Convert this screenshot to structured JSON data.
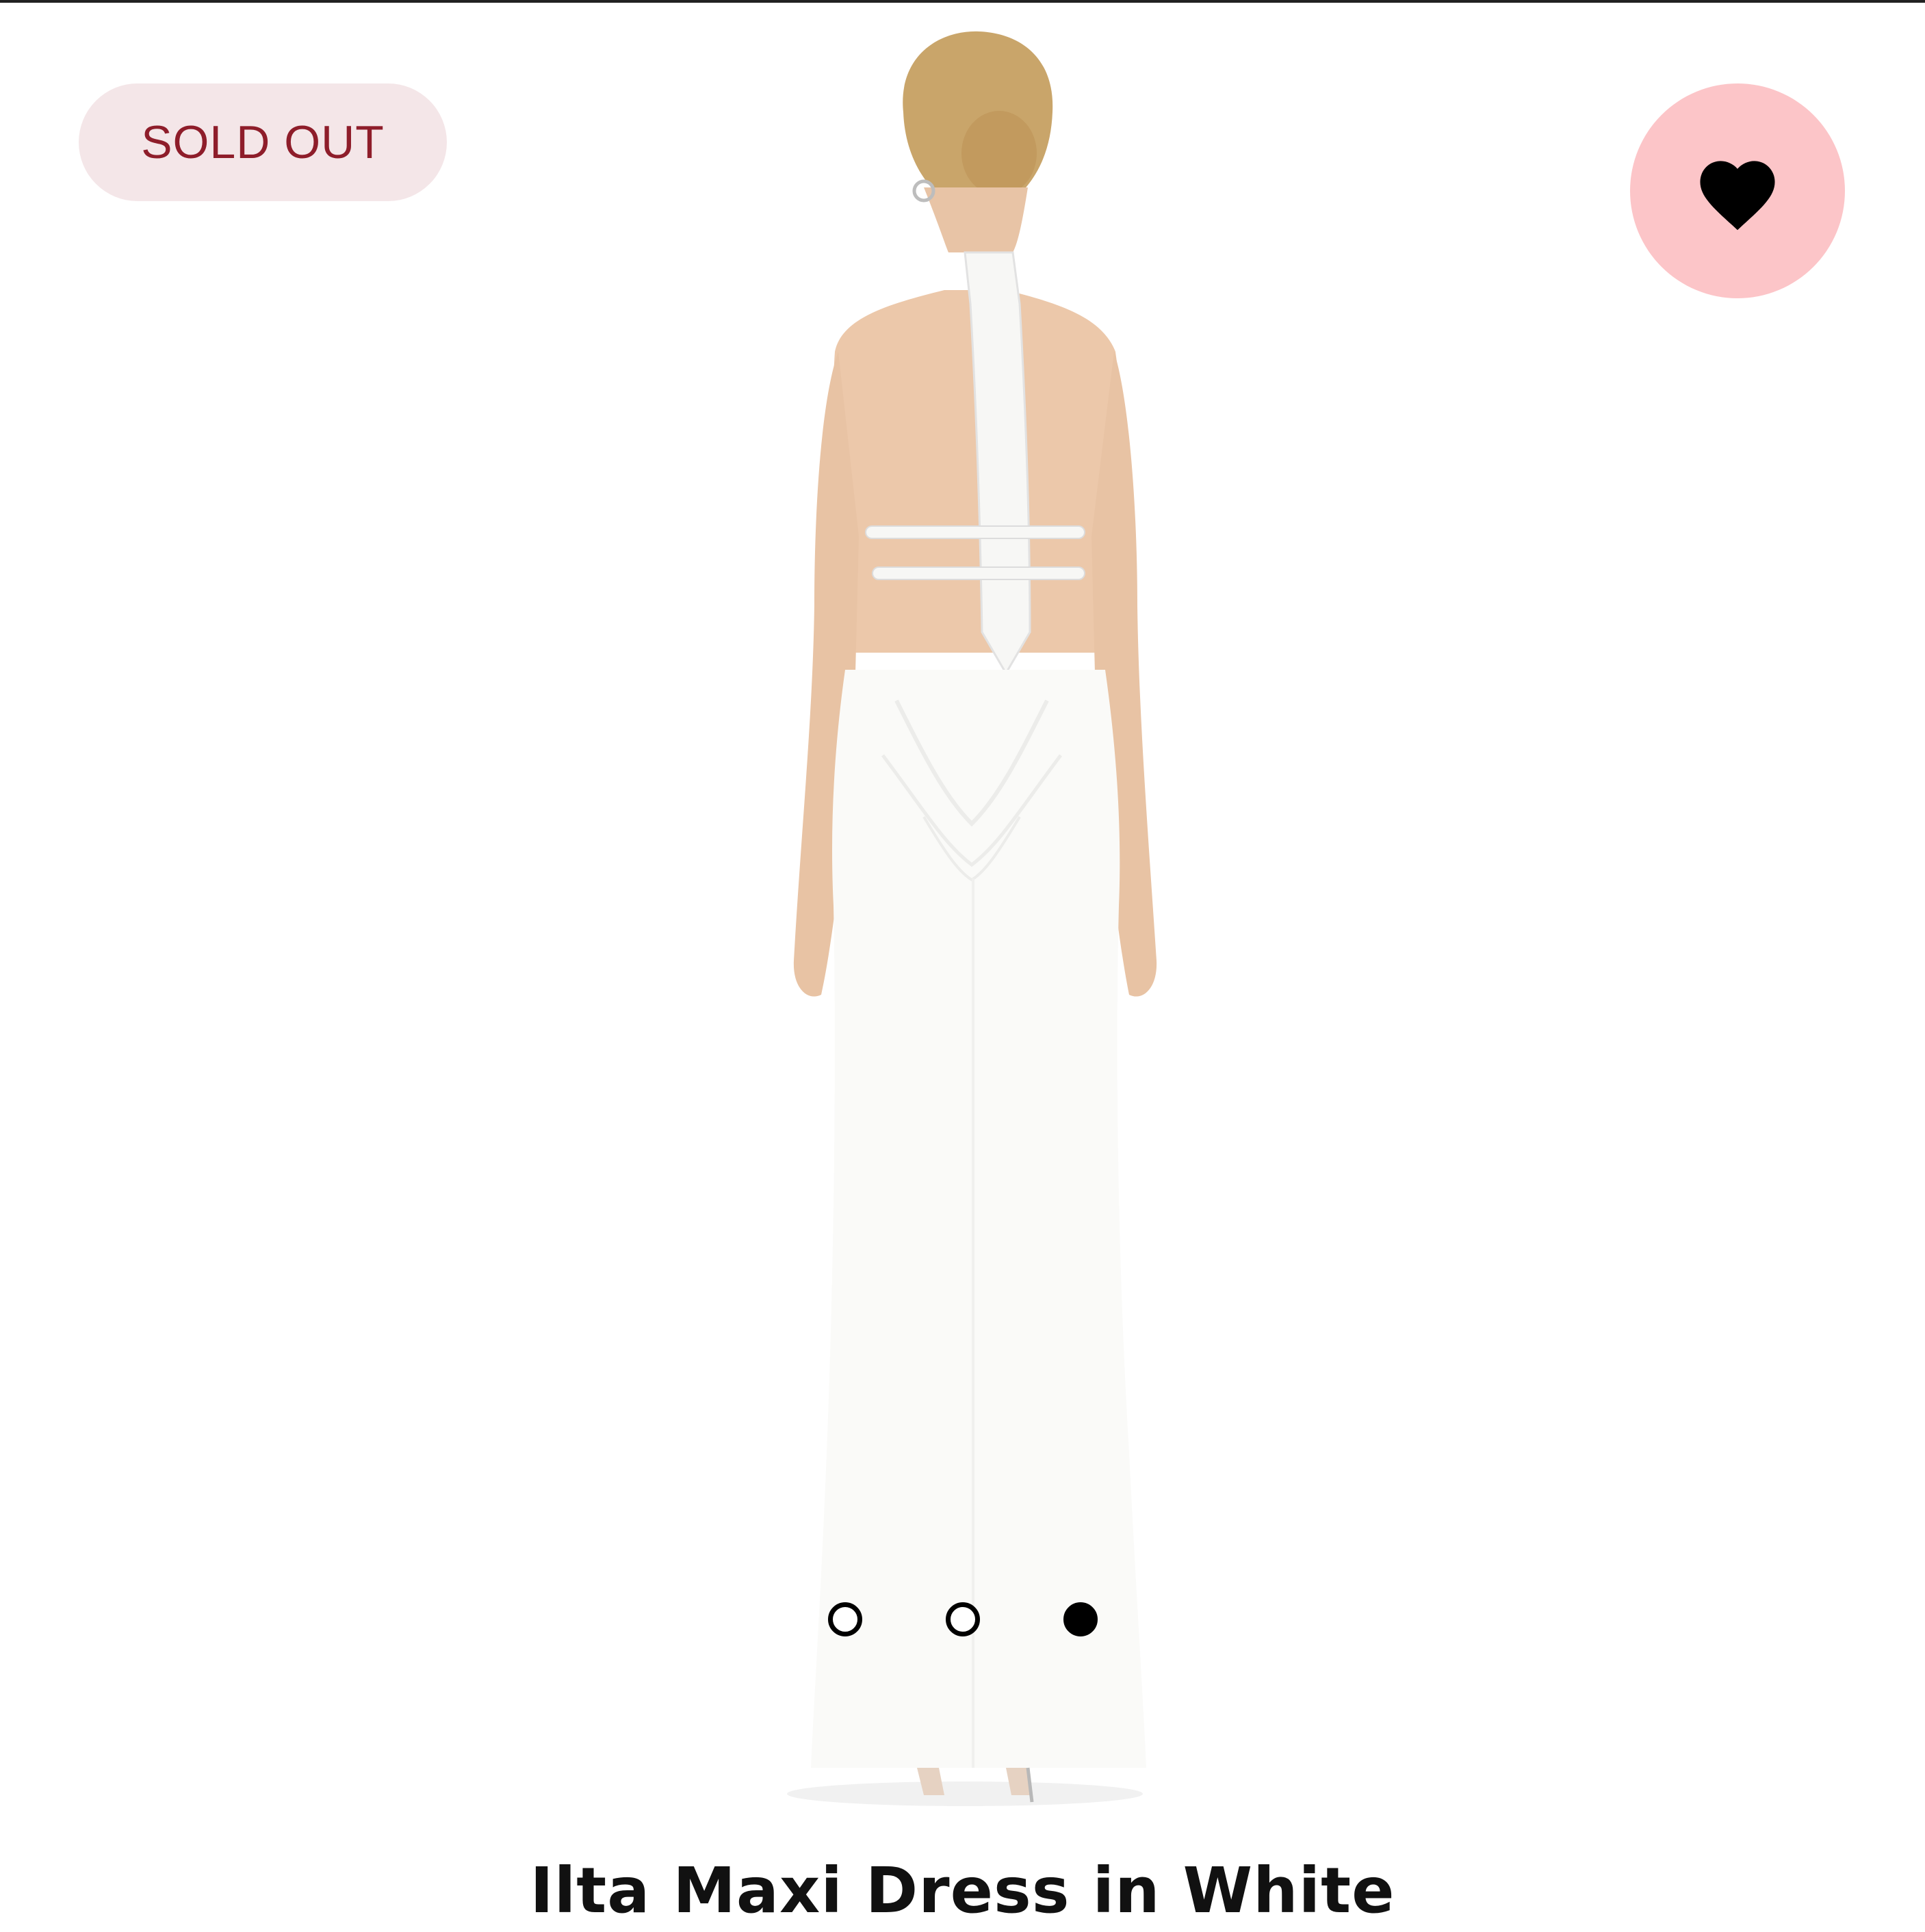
{
  "product": {
    "badge": "SOLD OUT",
    "title": "Ilta Maxi Dress in White",
    "favorite_icon": "heart-icon",
    "favorited": true
  },
  "gallery": {
    "image_count": 3,
    "active_index": 2
  },
  "colors": {
    "badge_bg": "#f4e6e8",
    "badge_text": "#8e1d2a",
    "favorite_bg": "#fcc5c8",
    "heart": "#000000"
  }
}
